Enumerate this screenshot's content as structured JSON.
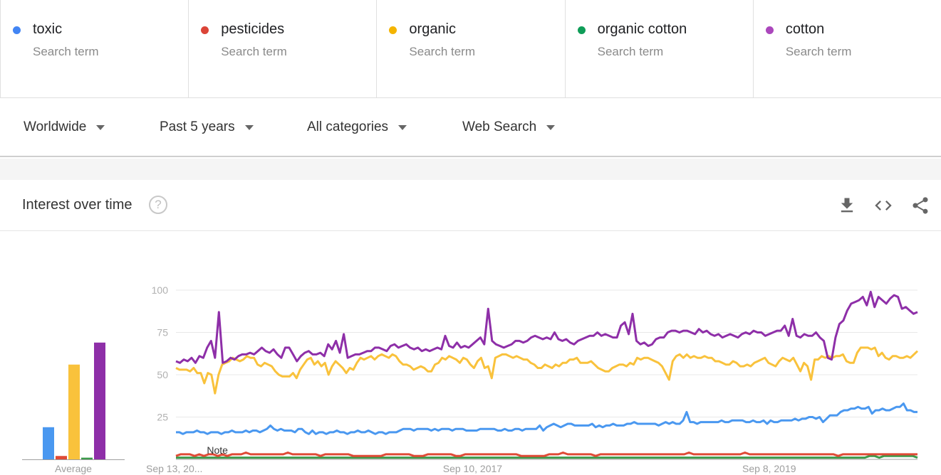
{
  "search_terms": [
    {
      "name": "toxic",
      "subtitle": "Search term",
      "color": "#4285f4"
    },
    {
      "name": "pesticides",
      "subtitle": "Search term",
      "color": "#db4437"
    },
    {
      "name": "organic",
      "subtitle": "Search term",
      "color": "#f4b400"
    },
    {
      "name": "organic cotton",
      "subtitle": "Search term",
      "color": "#0f9d58"
    },
    {
      "name": "cotton",
      "subtitle": "Search term",
      "color": "#ab47bc"
    }
  ],
  "filters": {
    "region": "Worldwide",
    "time_range": "Past 5 years",
    "category": "All categories",
    "search_type": "Web Search"
  },
  "card": {
    "title": "Interest over time",
    "help_icon": "?",
    "actions": [
      "download-icon",
      "embed-icon",
      "share-icon"
    ]
  },
  "chart_data": {
    "type": "line",
    "title": "Interest over time",
    "xlabel": "",
    "ylabel": "",
    "ylim": [
      0,
      100
    ],
    "yticks": [
      25,
      50,
      75,
      100
    ],
    "xtick_labels": [
      "Sep 13, 20...",
      "Sep 10, 2017",
      "Sep 8, 2019"
    ],
    "xtick_positions": [
      0,
      0.4,
      0.8
    ],
    "grid": true,
    "annotation": "Note",
    "annotation_position": 0.057,
    "average": {
      "label": "Average",
      "values": {
        "toxic": 19,
        "pesticides": 2,
        "organic": 56,
        "organic cotton": 1,
        "cotton": 69
      }
    },
    "series": [
      {
        "name": "cotton",
        "color": "#8e2fa8",
        "values": [
          58,
          57,
          59,
          58,
          60,
          57,
          61,
          60,
          66,
          70,
          60,
          87,
          57,
          58,
          60,
          59,
          61,
          62,
          62,
          63,
          62,
          64,
          66,
          64,
          63,
          65,
          62,
          60,
          66,
          66,
          62,
          58,
          61,
          63,
          64,
          62,
          62,
          63,
          61,
          68,
          65,
          70,
          63,
          74,
          60,
          61,
          62,
          62,
          63,
          64,
          64,
          66,
          66,
          65,
          64,
          67,
          68,
          66,
          67,
          68,
          66,
          65,
          66,
          64,
          65,
          64,
          65,
          66,
          65,
          73,
          67,
          66,
          69,
          66,
          67,
          66,
          68,
          70,
          72,
          68,
          89,
          70,
          68,
          67,
          66,
          67,
          68,
          70,
          70,
          69,
          70,
          72,
          73,
          72,
          71,
          72,
          71,
          75,
          71,
          70,
          71,
          69,
          68,
          70,
          71,
          72,
          73,
          73,
          75,
          73,
          74,
          73,
          72,
          72,
          79,
          81,
          74,
          86,
          70,
          68,
          69,
          67,
          68,
          71,
          72,
          72,
          75,
          76,
          76,
          75,
          76,
          76,
          75,
          74,
          77,
          75,
          76,
          74,
          73,
          74,
          72,
          73,
          74,
          73,
          72,
          74,
          75,
          74,
          76,
          75,
          75,
          73,
          74,
          75,
          76,
          76,
          79,
          73,
          83,
          73,
          72,
          74,
          73,
          73,
          75,
          72,
          70,
          60,
          59,
          72,
          80,
          82,
          88,
          92,
          93,
          94,
          96,
          91,
          99,
          90,
          96,
          94,
          92,
          95,
          97,
          96,
          89,
          90,
          88,
          86,
          87
        ]
      },
      {
        "name": "organic",
        "color": "#f9c23c",
        "values": [
          54,
          53,
          53,
          53,
          52,
          54,
          51,
          51,
          45,
          51,
          50,
          39,
          50,
          56,
          57,
          58,
          60,
          59,
          58,
          59,
          61,
          60,
          60,
          56,
          55,
          57,
          56,
          55,
          52,
          50,
          49,
          49,
          49,
          51,
          48,
          53,
          56,
          59,
          60,
          56,
          58,
          55,
          57,
          50,
          55,
          58,
          56,
          54,
          51,
          54,
          53,
          57,
          60,
          59,
          60,
          61,
          59,
          61,
          62,
          61,
          60,
          62,
          61,
          58,
          56,
          56,
          55,
          53,
          54,
          55,
          54,
          52,
          52,
          56,
          57,
          60,
          59,
          61,
          60,
          59,
          57,
          60,
          59,
          56,
          54,
          58,
          60,
          54,
          55,
          48,
          60,
          61,
          62,
          62,
          61,
          60,
          61,
          60,
          59,
          59,
          57,
          56,
          54,
          54,
          56,
          55,
          54,
          56,
          55,
          57,
          57,
          59,
          59,
          60,
          57,
          57,
          57,
          58,
          56,
          54,
          53,
          52,
          52,
          54,
          55,
          56,
          56,
          55,
          57,
          56,
          60,
          59,
          60,
          60,
          59,
          58,
          57,
          55,
          51,
          47,
          58,
          61,
          62,
          60,
          62,
          60,
          61,
          60,
          60,
          61,
          60,
          60,
          58,
          58,
          57,
          56,
          56,
          58,
          57,
          55,
          55,
          56,
          55,
          57,
          58,
          59,
          60,
          57,
          56,
          55,
          58,
          60,
          59,
          58,
          60,
          56,
          52,
          57,
          55,
          47,
          59,
          59,
          61,
          60,
          61,
          60,
          61,
          61,
          62,
          58,
          57,
          57,
          63,
          66,
          66,
          66,
          65,
          66,
          61,
          63,
          60,
          59,
          61,
          61,
          60,
          60,
          61,
          60,
          62,
          64
        ]
      },
      {
        "name": "toxic",
        "color": "#4a98f0",
        "values": [
          16,
          16,
          15,
          16,
          16,
          16,
          17,
          16,
          16,
          15,
          16,
          16,
          16,
          15,
          16,
          16,
          17,
          16,
          16,
          16,
          17,
          16,
          17,
          17,
          16,
          17,
          18,
          20,
          18,
          17,
          18,
          17,
          17,
          17,
          16,
          18,
          18,
          16,
          15,
          17,
          15,
          16,
          16,
          15,
          16,
          16,
          17,
          16,
          16,
          15,
          16,
          16,
          17,
          16,
          16,
          17,
          16,
          15,
          16,
          16,
          15,
          16,
          16,
          16,
          17,
          18,
          18,
          18,
          17,
          18,
          18,
          18,
          18,
          17,
          18,
          17,
          18,
          18,
          18,
          17,
          18,
          18,
          18,
          17,
          17,
          17,
          17,
          18,
          18,
          18,
          18,
          18,
          17,
          17,
          18,
          17,
          17,
          18,
          18,
          17,
          18,
          18,
          18,
          18,
          20,
          17,
          19,
          20,
          21,
          20,
          19,
          20,
          21,
          21,
          20,
          20,
          20,
          20,
          20,
          21,
          19,
          20,
          19,
          20,
          20,
          21,
          20,
          20,
          20,
          21,
          21,
          22,
          21,
          21,
          21,
          21,
          21,
          21,
          20,
          21,
          22,
          21,
          22,
          21,
          21,
          23,
          28,
          22,
          22,
          21,
          22,
          22,
          22,
          22,
          22,
          22,
          23,
          22,
          22,
          23,
          23,
          23,
          23,
          22,
          22,
          23,
          22,
          22,
          23,
          21,
          23,
          22,
          22,
          23,
          23,
          23,
          23,
          24,
          23,
          24,
          24,
          25,
          25,
          24,
          25,
          22,
          24,
          26,
          26,
          26,
          28,
          29,
          29,
          30,
          30,
          31,
          30,
          30,
          31,
          27,
          29,
          29,
          30,
          29,
          29,
          30,
          31,
          31,
          33,
          29,
          29,
          28,
          28
        ]
      },
      {
        "name": "pesticides",
        "color": "#df4a36",
        "values": [
          2,
          3,
          3,
          3,
          2,
          3,
          2,
          3,
          3,
          2,
          3,
          2,
          3,
          3,
          3,
          4,
          3,
          3,
          3,
          3,
          3,
          3,
          3,
          3,
          4,
          3,
          3,
          3,
          3,
          3,
          3,
          2,
          3,
          3,
          3,
          3,
          3,
          3,
          2,
          2,
          2,
          2,
          2,
          2,
          2,
          3,
          3,
          3,
          3,
          3,
          3,
          2,
          2,
          2,
          3,
          3,
          3,
          3,
          3,
          3,
          2,
          2,
          3,
          3,
          3,
          3,
          3,
          3,
          3,
          3,
          3,
          3,
          3,
          3,
          2,
          2,
          2,
          2,
          2,
          2,
          3,
          3,
          3,
          4,
          3,
          3,
          3,
          3,
          3,
          3,
          2,
          3,
          3,
          3,
          3,
          3,
          3,
          3,
          3,
          3,
          3,
          3,
          3,
          3,
          3,
          3,
          3,
          3,
          3,
          3,
          4,
          3,
          3,
          3,
          3,
          3,
          3,
          3,
          3,
          3,
          3,
          3,
          4,
          3,
          3,
          3,
          3,
          3,
          3,
          3,
          3,
          3,
          3,
          3,
          3,
          3,
          3,
          3,
          3,
          3,
          3,
          3,
          2,
          3,
          3,
          3,
          3,
          3,
          3,
          3,
          3,
          3,
          3,
          3,
          3,
          3,
          3,
          3,
          3,
          3
        ]
      },
      {
        "name": "organic cotton",
        "color": "#3c9a4a",
        "values": [
          1,
          1,
          1,
          1,
          1,
          1,
          1,
          1,
          1,
          1,
          1,
          1,
          1,
          1,
          1,
          1,
          1,
          1,
          1,
          1,
          1,
          1,
          1,
          1,
          1,
          1,
          1,
          1,
          1,
          1,
          1,
          1,
          1,
          1,
          1,
          1,
          1,
          1,
          1,
          1,
          1,
          1,
          1,
          1,
          1,
          1,
          1,
          1,
          1,
          1,
          1,
          1,
          1,
          1,
          1,
          1,
          1,
          1,
          1,
          1,
          1,
          1,
          1,
          1,
          1,
          1,
          1,
          1,
          1,
          1,
          1,
          1,
          1,
          1,
          1,
          1,
          1,
          1,
          1,
          1,
          1,
          1,
          1,
          1,
          1,
          1,
          1,
          1,
          1,
          1,
          1,
          1,
          1,
          1,
          1,
          1,
          1,
          1,
          1,
          1,
          1,
          1,
          1,
          1,
          1,
          1,
          1,
          1,
          1,
          1,
          1,
          1,
          1,
          1,
          1,
          1,
          1,
          1,
          1,
          1,
          1,
          1,
          1,
          1,
          1,
          1,
          1,
          1,
          1,
          1,
          1,
          1,
          1,
          1,
          1,
          1,
          1,
          1,
          1,
          1,
          1,
          1,
          1,
          1,
          1,
          2,
          2,
          1,
          2,
          2,
          2,
          2,
          2,
          2,
          2,
          1
        ]
      }
    ]
  }
}
